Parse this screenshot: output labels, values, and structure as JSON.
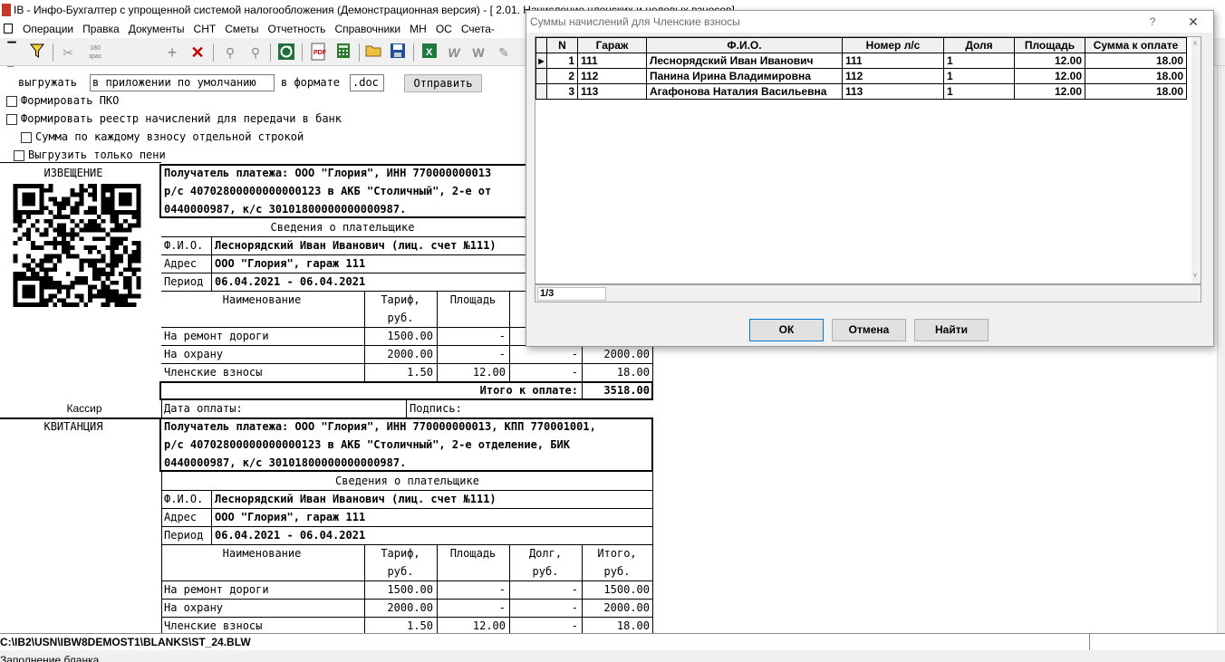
{
  "window": {
    "title": "IB - Инфо-Бухгалтер с упрощенной системой налогообложения (Демонстрационная версия) - [ 2.01. Начисление членских и целевых взносов]"
  },
  "menu": [
    "Операции",
    "Правка",
    "Документы",
    "СНТ",
    "Сметы",
    "Отчетность",
    "Справочники",
    "МН",
    "ОС",
    "Счета-"
  ],
  "toolbar": {
    "icons": [
      "bracket-icon",
      "filter-icon",
      "cut-icon",
      "numbers-icon",
      "plus-icon",
      "delete-icon",
      "wand-icon",
      "wand2-icon",
      "refresh-icon",
      "pdf-icon",
      "calculator-icon",
      "open-folder-icon",
      "save-icon",
      "excel-icon",
      "word-icon",
      "word2-icon"
    ],
    "numbers_label": "180\nзрас"
  },
  "form": {
    "export_label": "выгружать",
    "export_value": "в приложении по умолчанию",
    "format_label": "в формате",
    "format_value": ".doc",
    "send_button": "Отправить",
    "pko_label": "Формировать ПКО",
    "register_label": "Формировать реестр начислений для передачи в банк",
    "separate_label": "Сумма по каждому взносу отдельной строкой",
    "penalty_label": "Выгрузить только пени"
  },
  "notice": {
    "label": "ИЗВЕЩЕНИЕ",
    "cashier": "Кассир",
    "recipient": [
      "Получатель платежа: ООО \"Глория\", ИНН 770000000013",
      "р/с 40702800000000000123 в АКБ \"Столичный\", 2-е от",
      "0440000987, к/с 30101800000000000987."
    ],
    "payer_header": "Сведения о плательщике",
    "fio_label": "Ф.И.О.",
    "fio_value": "Леснорядский Иван Иванович (лиц. счет №111)",
    "address_label": "Адрес",
    "address_value": "ООО \"Глория\", гараж 111",
    "period_label": "Период",
    "period_value": "06.04.2021 - 06.04.2021",
    "col_name": "Наименование",
    "col_tariff": [
      "Тариф,",
      "руб."
    ],
    "col_area": "Площадь",
    "rows": [
      {
        "name": "На ремонт дороги",
        "tariff": "1500.00",
        "area": "-",
        "debt": "",
        "total": ""
      },
      {
        "name": "На охрану",
        "tariff": "2000.00",
        "area": "-",
        "debt": "-",
        "total": "2000.00"
      },
      {
        "name": "Членские взносы",
        "tariff": "1.50",
        "area": "12.00",
        "debt": "-",
        "total": "18.00"
      }
    ],
    "total_label": "Итого к оплате:",
    "total_value": "3518.00",
    "pay_date": "Дата оплаты:",
    "signature": "Подпись:"
  },
  "receipt": {
    "label": "КВИТАНЦИЯ",
    "recipient": [
      "Получатель платежа: ООО \"Глория\", ИНН 770000000013, КПП 770001001,",
      "р/с 40702800000000000123 в АКБ \"Столичный\", 2-е отделение, БИК",
      "0440000987, к/с 30101800000000000987."
    ],
    "payer_header": "Сведения о плательщике",
    "fio_label": "Ф.И.О.",
    "fio_value": "Леснорядский Иван Иванович (лиц. счет №111)",
    "address_label": "Адрес",
    "address_value": "ООО \"Глория\", гараж 111",
    "period_label": "Период",
    "period_value": "06.04.2021 - 06.04.2021",
    "col_name": "Наименование",
    "col_tariff": [
      "Тариф,",
      "руб."
    ],
    "col_area": "Площадь",
    "col_debt": [
      "Долг,",
      "руб."
    ],
    "col_total": [
      "Итого,",
      "руб."
    ],
    "rows": [
      {
        "name": "На ремонт дороги",
        "tariff": "1500.00",
        "area": "-",
        "debt": "-",
        "total": "1500.00"
      },
      {
        "name": "На охрану",
        "tariff": "2000.00",
        "area": "-",
        "debt": "-",
        "total": "2000.00"
      },
      {
        "name": "Членские взносы",
        "tariff": "1.50",
        "area": "12.00",
        "debt": "-",
        "total": "18.00"
      }
    ]
  },
  "status": {
    "path": "C:\\IB2\\USN\\IBW8DEMOST1\\BLANKS\\ST_24.BLW",
    "mode": "Заполнение бланка"
  },
  "dialog": {
    "title": "Суммы начислений для Членские взносы",
    "help": "?",
    "close": "✕",
    "columns": [
      "N",
      "Гараж",
      "Ф.И.О.",
      "Номер л/с",
      "Доля",
      "Площадь",
      "Сумма к оплате"
    ],
    "rows": [
      {
        "n": "1",
        "garage": "111",
        "fio": "Леснорядский Иван Иванович",
        "account": "111",
        "share": "1",
        "area": "12.00",
        "sum": "18.00"
      },
      {
        "n": "2",
        "garage": "112",
        "fio": "Панина Ирина Владимировна",
        "account": "112",
        "share": "1",
        "area": "12.00",
        "sum": "18.00"
      },
      {
        "n": "3",
        "garage": "113",
        "fio": "Агафонова Наталия Васильевна",
        "account": "113",
        "share": "1",
        "area": "12.00",
        "sum": "18.00"
      }
    ],
    "counter": "1/3",
    "ok": "ОК",
    "cancel": "Отмена",
    "find": "Найти"
  }
}
